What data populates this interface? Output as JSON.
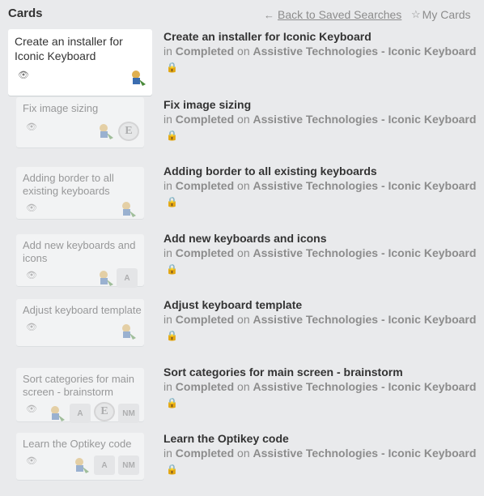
{
  "header": {
    "title": "Cards",
    "back_label": "Back to Saved Searches",
    "mycards_label": "My Cards"
  },
  "meta_words": {
    "in": "in",
    "on": "on"
  },
  "cards": [
    {
      "card_title": "Create an installer for Iconic Keyboard",
      "title": "Create an installer for Iconic Keyboard",
      "list": "Completed",
      "board": "Assistive Technologies - Iconic Keyboard",
      "badges": []
    },
    {
      "card_title": "Fix image sizing",
      "title": "Fix image sizing",
      "list": "Completed",
      "board": "Assistive Technologies - Iconic Keyboard",
      "badges": [
        "E"
      ]
    },
    {
      "card_title": "Adding border to all existing keyboards",
      "title": "Adding border to all existing keyboards",
      "list": "Completed",
      "board": "Assistive Technologies - Iconic Keyboard",
      "badges": []
    },
    {
      "card_title": "Add new keyboards and icons",
      "title": "Add new keyboards and icons",
      "list": "Completed",
      "board": "Assistive Technologies - Iconic Keyboard",
      "badges": [
        "A"
      ]
    },
    {
      "card_title": "Adjust keyboard template",
      "title": "Adjust keyboard template",
      "list": "Completed",
      "board": "Assistive Technologies - Iconic Keyboard",
      "badges": []
    },
    {
      "card_title": "Sort categories for main screen - brainstorm",
      "title": "Sort categories for main screen - brainstorm",
      "list": "Completed",
      "board": "Assistive Technologies - Iconic Keyboard",
      "badges": [
        "A",
        "E",
        "NM"
      ]
    },
    {
      "card_title": "Learn the Optikey code",
      "title": "Learn the Optikey code",
      "list": "Completed",
      "board": "Assistive Technologies - Iconic Keyboard",
      "badges": [
        "A",
        "NM"
      ]
    }
  ],
  "colors": {
    "background": "#e9eaec",
    "lock": "#eb5a46",
    "muted": "#8c8c8c"
  },
  "icons": {
    "eye": "eye-icon",
    "lock": "lock-icon",
    "back": "arrow-left-icon",
    "star": "star-icon"
  }
}
